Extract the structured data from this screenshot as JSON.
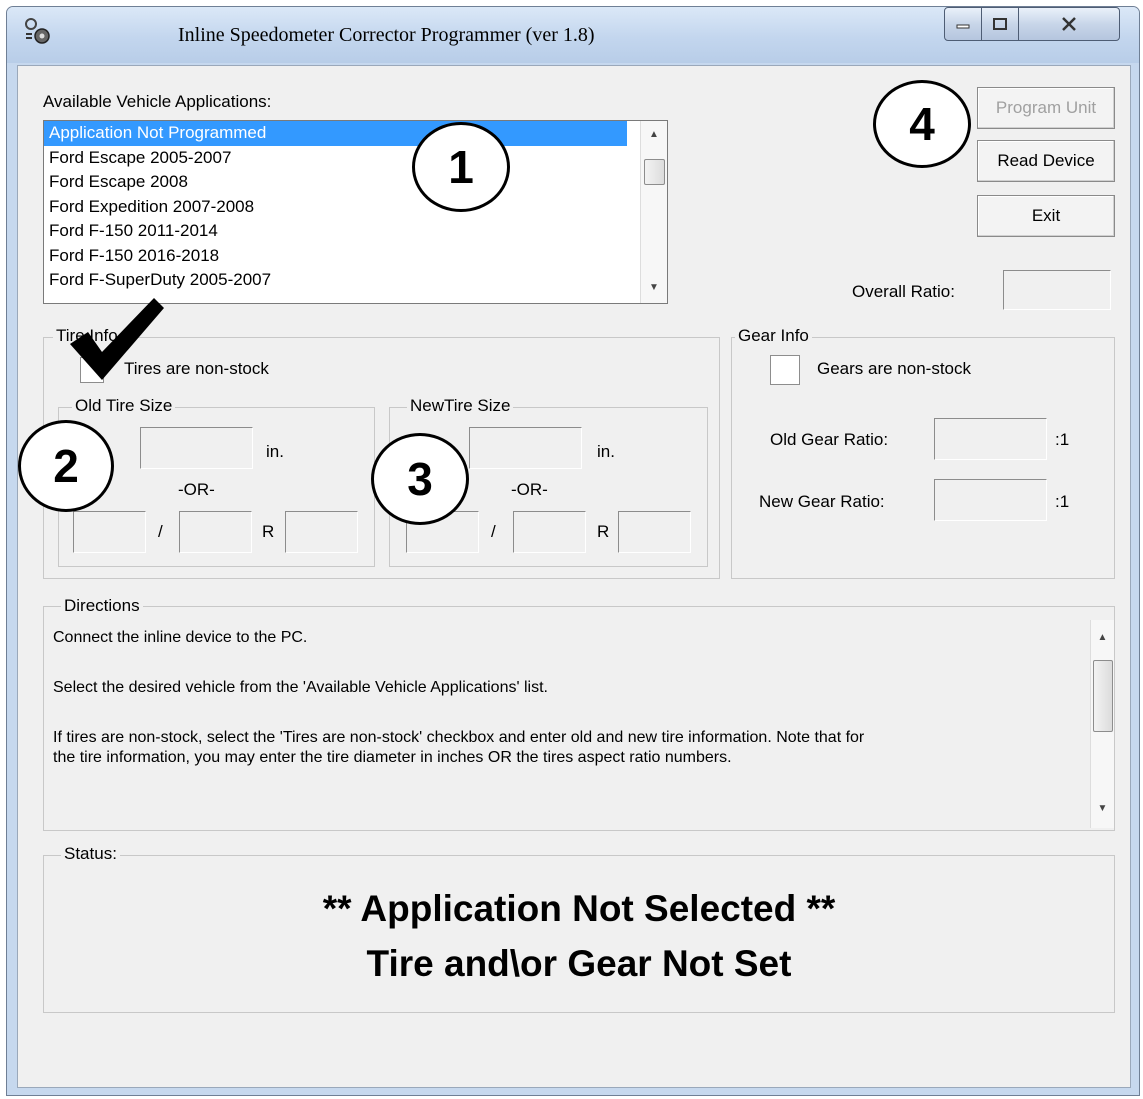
{
  "window": {
    "title": "Inline Speedometer Corrector Programmer (ver 1.8)",
    "icon": "app-gear-icon"
  },
  "applications": {
    "label": "Available Vehicle Applications:",
    "items": [
      "Application Not Programmed",
      "Ford Escape 2005-2007",
      "Ford Escape 2008",
      "Ford Expedition 2007-2008",
      "Ford F-150 2011-2014",
      "Ford F-150 2016-2018",
      "Ford F-SuperDuty 2005-2007"
    ],
    "selected_index": 0
  },
  "buttons": {
    "program_unit": "Program Unit",
    "read_device": "Read Device",
    "exit": "Exit"
  },
  "overall_ratio": {
    "label": "Overall Ratio:",
    "value": ""
  },
  "tire_info": {
    "legend": "Tire Info",
    "checkbox_label": "Tires are non-stock",
    "old_legend": "Old Tire Size",
    "new_legend": "NewTire Size",
    "in_label": "in.",
    "or_label": "-OR-",
    "slash": "/",
    "r_label": "R"
  },
  "gear_info": {
    "legend": "Gear Info",
    "checkbox_label": "Gears are non-stock",
    "old_label": "Old Gear Ratio:",
    "new_label": "New Gear Ratio:",
    "ratio_suffix": ":1"
  },
  "directions": {
    "legend": "Directions",
    "lines": [
      "Connect the inline device to the PC.",
      "Select the desired vehicle from the 'Available Vehicle Applications' list.",
      "If tires are non-stock, select the 'Tires are non-stock' checkbox and enter old and new tire information.  Note that for",
      "the tire information, you may enter the tire diameter in inches OR the tires aspect ratio numbers."
    ]
  },
  "status": {
    "legend": "Status:",
    "line1": "** Application Not Selected **",
    "line2": "Tire and\\or Gear Not Set"
  },
  "callouts": [
    "1",
    "2",
    "3",
    "4"
  ]
}
